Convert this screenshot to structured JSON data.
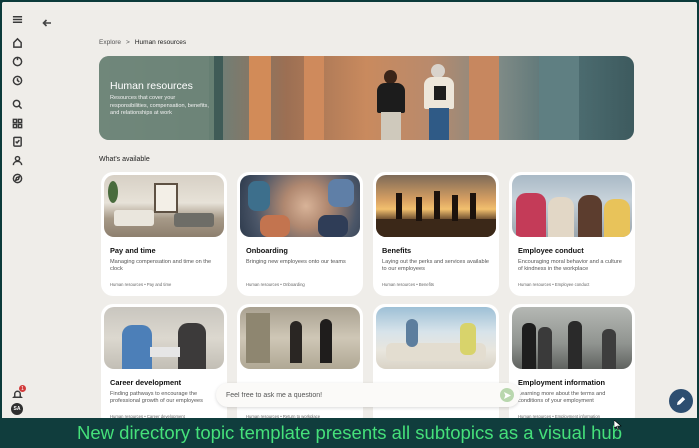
{
  "nav": {
    "back_icon": "arrow-left-icon",
    "rail_icons": [
      "menu-icon",
      "home-icon",
      "copilot-icon",
      "history-icon",
      "search-icon",
      "apps-icon",
      "tasks-icon",
      "people-icon",
      "explore-icon"
    ],
    "notification_count": "1",
    "avatar_initials": "SA"
  },
  "breadcrumb": {
    "parent": "Explore",
    "separator": ">",
    "current": "Human resources"
  },
  "hero": {
    "title": "Human resources",
    "description": "Resources that cover your responsibilities, compensation, benefits, and relationships at work"
  },
  "section": {
    "label": "What's available"
  },
  "cards": [
    {
      "title": "Pay and time",
      "description": "Managing compensation and time on the clock",
      "meta": "Human resources • Pay and time"
    },
    {
      "title": "Onboarding",
      "description": "Bringing new employees onto our teams",
      "meta": "Human resources • Onboarding"
    },
    {
      "title": "Benefits",
      "description": "Laying out the perks and services available to our employees",
      "meta": "Human resources • Benefits"
    },
    {
      "title": "Employee conduct",
      "description": "Encouraging moral behavior and a culture of kindness in the workplace",
      "meta": "Human resources • Employee conduct"
    },
    {
      "title": "Career development",
      "description": "Finding pathways to encourage the professional growth of our employees",
      "meta": "Human resources • Career development"
    },
    {
      "title": "",
      "description": "",
      "meta": "Human resources • Return to workplace"
    },
    {
      "title": "",
      "description": "",
      "meta": ""
    },
    {
      "title": "Employment information",
      "description": "Learning more about the terms and conditions of your employment",
      "meta": "Human resources • Employment information"
    }
  ],
  "chat": {
    "placeholder": "Feel free to ask me a question!"
  },
  "caption": "New directory topic template presents all subtopics as a visual hub",
  "colors": {
    "background": "#efede9",
    "caption_bar": "#103d3d",
    "caption_text": "#45e07a",
    "fab": "#2d4e70",
    "badge": "#d23b3b"
  }
}
